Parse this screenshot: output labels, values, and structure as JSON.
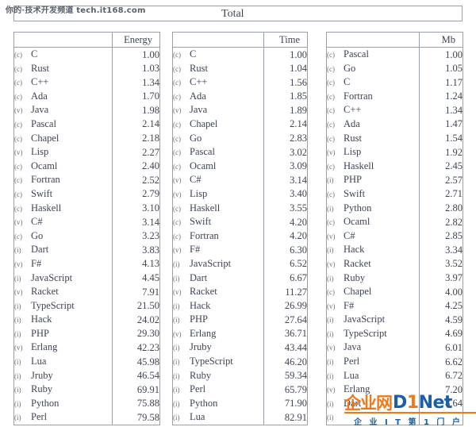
{
  "watermarks": {
    "top": "你的·技术开发频道 tech.it168.com",
    "logo_cn": "企业网",
    "logo_brand_pre": "D",
    "logo_brand_one": "1",
    "logo_brand_post": "Net",
    "logo_tagline": "企 业 I T 第 1 门 户"
  },
  "total_bar": {
    "label": "Total"
  },
  "tables": [
    {
      "id": "energy",
      "name_header": "",
      "value_header": "Energy",
      "rows": [
        {
          "tag": "(c)",
          "lang": "C",
          "value": "1.00"
        },
        {
          "tag": "(c)",
          "lang": "Rust",
          "value": "1.03"
        },
        {
          "tag": "(c)",
          "lang": "C++",
          "value": "1.34"
        },
        {
          "tag": "(c)",
          "lang": "Ada",
          "value": "1.70"
        },
        {
          "tag": "(v)",
          "lang": "Java",
          "value": "1.98"
        },
        {
          "tag": "(c)",
          "lang": "Pascal",
          "value": "2.14"
        },
        {
          "tag": "(c)",
          "lang": "Chapel",
          "value": "2.18"
        },
        {
          "tag": "(v)",
          "lang": "Lisp",
          "value": "2.27"
        },
        {
          "tag": "(c)",
          "lang": "Ocaml",
          "value": "2.40"
        },
        {
          "tag": "(c)",
          "lang": "Fortran",
          "value": "2.52"
        },
        {
          "tag": "(c)",
          "lang": "Swift",
          "value": "2.79"
        },
        {
          "tag": "(c)",
          "lang": "Haskell",
          "value": "3.10"
        },
        {
          "tag": "(v)",
          "lang": "C#",
          "value": "3.14"
        },
        {
          "tag": "(c)",
          "lang": "Go",
          "value": "3.23"
        },
        {
          "tag": "(i)",
          "lang": "Dart",
          "value": "3.83"
        },
        {
          "tag": "(v)",
          "lang": "F#",
          "value": "4.13"
        },
        {
          "tag": "(i)",
          "lang": "JavaScript",
          "value": "4.45"
        },
        {
          "tag": "(v)",
          "lang": "Racket",
          "value": "7.91"
        },
        {
          "tag": "(i)",
          "lang": "TypeScript",
          "value": "21.50"
        },
        {
          "tag": "(i)",
          "lang": "Hack",
          "value": "24.02"
        },
        {
          "tag": "(i)",
          "lang": "PHP",
          "value": "29.30"
        },
        {
          "tag": "(v)",
          "lang": "Erlang",
          "value": "42.23"
        },
        {
          "tag": "(i)",
          "lang": "Lua",
          "value": "45.98"
        },
        {
          "tag": "(i)",
          "lang": "Jruby",
          "value": "46.54"
        },
        {
          "tag": "(i)",
          "lang": "Ruby",
          "value": "69.91"
        },
        {
          "tag": "(i)",
          "lang": "Python",
          "value": "75.88"
        },
        {
          "tag": "(i)",
          "lang": "Perl",
          "value": "79.58"
        }
      ]
    },
    {
      "id": "time",
      "name_header": "",
      "value_header": "Time",
      "rows": [
        {
          "tag": "(c)",
          "lang": "C",
          "value": "1.00"
        },
        {
          "tag": "(c)",
          "lang": "Rust",
          "value": "1.04"
        },
        {
          "tag": "(c)",
          "lang": "C++",
          "value": "1.56"
        },
        {
          "tag": "(c)",
          "lang": "Ada",
          "value": "1.85"
        },
        {
          "tag": "(v)",
          "lang": "Java",
          "value": "1.89"
        },
        {
          "tag": "(c)",
          "lang": "Chapel",
          "value": "2.14"
        },
        {
          "tag": "(c)",
          "lang": "Go",
          "value": "2.83"
        },
        {
          "tag": "(c)",
          "lang": "Pascal",
          "value": "3.02"
        },
        {
          "tag": "(c)",
          "lang": "Ocaml",
          "value": "3.09"
        },
        {
          "tag": "(v)",
          "lang": "C#",
          "value": "3.14"
        },
        {
          "tag": "(v)",
          "lang": "Lisp",
          "value": "3.40"
        },
        {
          "tag": "(c)",
          "lang": "Haskell",
          "value": "3.55"
        },
        {
          "tag": "(c)",
          "lang": "Swift",
          "value": "4.20"
        },
        {
          "tag": "(c)",
          "lang": "Fortran",
          "value": "4.20"
        },
        {
          "tag": "(v)",
          "lang": "F#",
          "value": "6.30"
        },
        {
          "tag": "(i)",
          "lang": "JavaScript",
          "value": "6.52"
        },
        {
          "tag": "(i)",
          "lang": "Dart",
          "value": "6.67"
        },
        {
          "tag": "(v)",
          "lang": "Racket",
          "value": "11.27"
        },
        {
          "tag": "(i)",
          "lang": "Hack",
          "value": "26.99"
        },
        {
          "tag": "(i)",
          "lang": "PHP",
          "value": "27.64"
        },
        {
          "tag": "(v)",
          "lang": "Erlang",
          "value": "36.71"
        },
        {
          "tag": "(i)",
          "lang": "Jruby",
          "value": "43.44"
        },
        {
          "tag": "(i)",
          "lang": "TypeScript",
          "value": "46.20"
        },
        {
          "tag": "(i)",
          "lang": "Ruby",
          "value": "59.34"
        },
        {
          "tag": "(i)",
          "lang": "Perl",
          "value": "65.79"
        },
        {
          "tag": "(i)",
          "lang": "Python",
          "value": "71.90"
        },
        {
          "tag": "(i)",
          "lang": "Lua",
          "value": "82.91"
        }
      ]
    },
    {
      "id": "mb",
      "name_header": "",
      "value_header": "Mb",
      "rows": [
        {
          "tag": "(c)",
          "lang": "Pascal",
          "value": "1.00"
        },
        {
          "tag": "(c)",
          "lang": "Go",
          "value": "1.05"
        },
        {
          "tag": "(c)",
          "lang": "C",
          "value": "1.17"
        },
        {
          "tag": "(c)",
          "lang": "Fortran",
          "value": "1.24"
        },
        {
          "tag": "(c)",
          "lang": "C++",
          "value": "1.34"
        },
        {
          "tag": "(c)",
          "lang": "Ada",
          "value": "1.47"
        },
        {
          "tag": "(c)",
          "lang": "Rust",
          "value": "1.54"
        },
        {
          "tag": "(v)",
          "lang": "Lisp",
          "value": "1.92"
        },
        {
          "tag": "(c)",
          "lang": "Haskell",
          "value": "2.45"
        },
        {
          "tag": "(i)",
          "lang": "PHP",
          "value": "2.57"
        },
        {
          "tag": "(c)",
          "lang": "Swift",
          "value": "2.71"
        },
        {
          "tag": "(i)",
          "lang": "Python",
          "value": "2.80"
        },
        {
          "tag": "(c)",
          "lang": "Ocaml",
          "value": "2.82"
        },
        {
          "tag": "(v)",
          "lang": "C#",
          "value": "2.85"
        },
        {
          "tag": "(i)",
          "lang": "Hack",
          "value": "3.34"
        },
        {
          "tag": "(v)",
          "lang": "Racket",
          "value": "3.52"
        },
        {
          "tag": "(i)",
          "lang": "Ruby",
          "value": "3.97"
        },
        {
          "tag": "(c)",
          "lang": "Chapel",
          "value": "4.00"
        },
        {
          "tag": "(v)",
          "lang": "F#",
          "value": "4.25"
        },
        {
          "tag": "(i)",
          "lang": "JavaScript",
          "value": "4.59"
        },
        {
          "tag": "(i)",
          "lang": "TypeScript",
          "value": "4.69"
        },
        {
          "tag": "(v)",
          "lang": "Java",
          "value": "6.01"
        },
        {
          "tag": "(i)",
          "lang": "Perl",
          "value": "6.62"
        },
        {
          "tag": "(i)",
          "lang": "Lua",
          "value": "6.72"
        },
        {
          "tag": "(v)",
          "lang": "Erlang",
          "value": "7.20"
        },
        {
          "tag": "(i)",
          "lang": "Dart",
          "value": "8.64"
        },
        {
          "tag": "(i)",
          "lang": "",
          "value": ""
        }
      ]
    }
  ]
}
